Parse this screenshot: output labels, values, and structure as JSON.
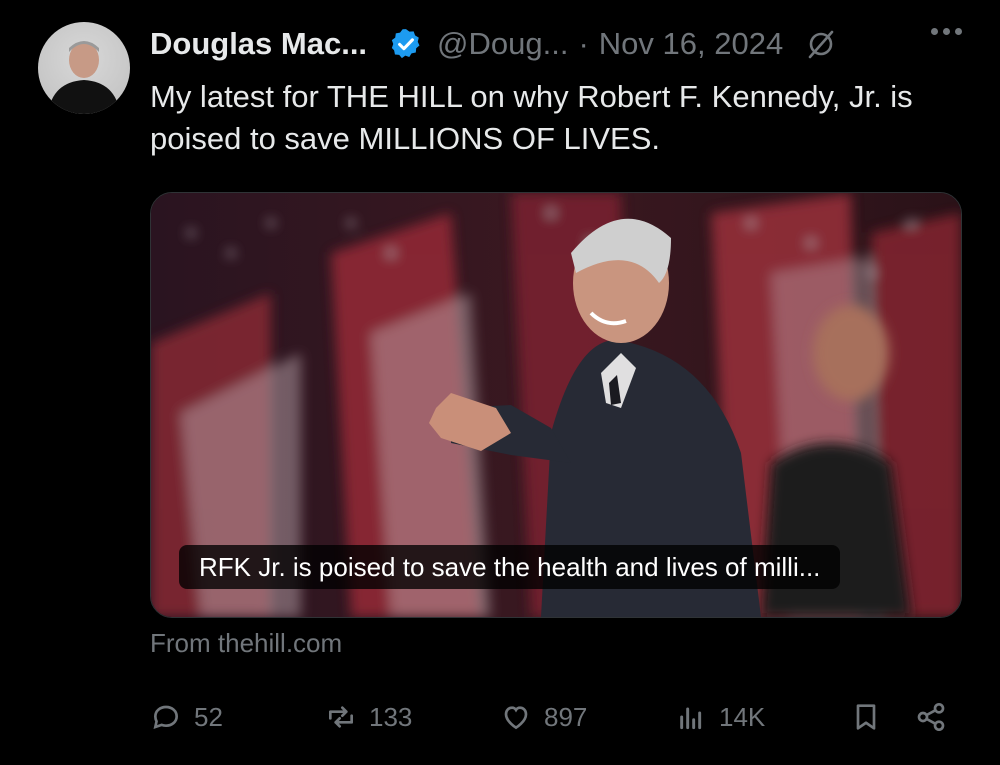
{
  "author": {
    "name": "Douglas Mac...",
    "handle": "@Doug...",
    "date": "Nov 16, 2024"
  },
  "post": {
    "text": "My latest for THE HILL on why Robert F. Kennedy, Jr. is poised to save MILLIONS OF LIVES."
  },
  "link_card": {
    "caption": "RFK Jr. is poised to save the health and lives of milli...",
    "source": "From thehill.com"
  },
  "actions": {
    "replies": "52",
    "reposts": "133",
    "likes": "897",
    "views": "14K"
  },
  "colors": {
    "background": "#000000",
    "text": "#e7e9ea",
    "muted": "#71767b",
    "verified": "#1d9bf0"
  },
  "icons": [
    "verified-badge-icon",
    "grok-icon",
    "more-icon",
    "reply-icon",
    "repost-icon",
    "like-icon",
    "views-icon",
    "bookmark-icon",
    "share-icon"
  ]
}
